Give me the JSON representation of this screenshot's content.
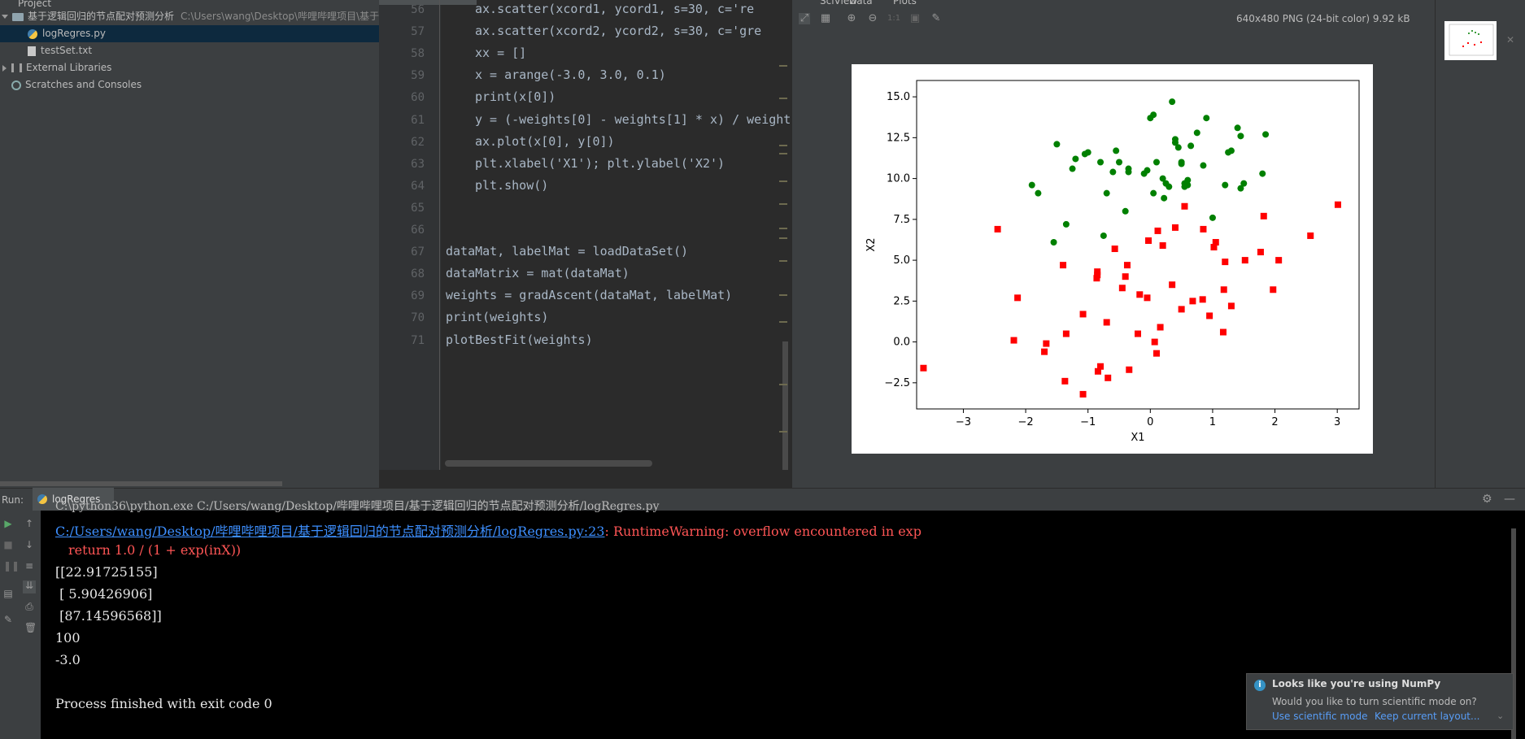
{
  "project": {
    "header_label": "Project",
    "root_folder": "基于逻辑回归的节点配对预测分析",
    "root_path": "C:\\Users\\wang\\Desktop\\哔哩哔哩项目\\基于逻",
    "files": [
      "logRegres.py",
      "testSet.txt"
    ],
    "external_libraries": "External Libraries",
    "scratches": "Scratches and Consoles"
  },
  "editor": {
    "tab_label": "logRegres.py",
    "line_numbers": [
      "56",
      "57",
      "58",
      "59",
      "60",
      "61",
      "62",
      "63",
      "64",
      "65",
      "66",
      "67",
      "68",
      "69",
      "70",
      "71"
    ],
    "lines": [
      "ax.scatter(xcord1, ycord1, s=30, c='re",
      "ax.scatter(xcord2, ycord2, s=30, c='gre",
      "xx = []",
      "x = arange(-3.0, 3.0, 0.1)",
      "print(x[0])",
      "y = (-weights[0] - weights[1] * x) / weight",
      "ax.plot(x[0], y[0])",
      "plt.xlabel('X1'); plt.ylabel('X2')",
      "plt.show()",
      "",
      "",
      "dataMat, labelMat = loadDataSet()",
      "dataMatrix = mat(dataMat)",
      "weights = gradAscent(dataMat, labelMat)",
      "print(weights)",
      "plotBestFit(weights)"
    ]
  },
  "viewer": {
    "tabs": [
      "SciView",
      "Data",
      "Plots"
    ],
    "image_info": "640x480 PNG (24-bit color) 9.92 kB",
    "zoom_one_to_one": "1:1"
  },
  "chart_data": {
    "type": "scatter",
    "title": "",
    "xlabel": "X1",
    "ylabel": "X2",
    "xlim": [
      -3.75,
      3.35
    ],
    "ylim": [
      -4.1,
      16.0
    ],
    "xticks": [
      "−3",
      "−2",
      "−1",
      "0",
      "1",
      "2",
      "3"
    ],
    "yticks": [
      "−2.5",
      "0.0",
      "2.5",
      "5.0",
      "7.5",
      "10.0",
      "12.5",
      "15.0"
    ],
    "xtick_values": [
      -3,
      -2,
      -1,
      0,
      1,
      2,
      3
    ],
    "ytick_values": [
      -2.5,
      0,
      2.5,
      5,
      7.5,
      10,
      12.5,
      15
    ],
    "series": [
      {
        "marker": "square",
        "color": "#ff0000",
        "points": [
          [
            -3.64,
            -1.6
          ],
          [
            -2.45,
            6.9
          ],
          [
            -2.13,
            2.7
          ],
          [
            -2.19,
            0.1
          ],
          [
            -1.67,
            -0.1
          ],
          [
            -1.7,
            -0.6
          ],
          [
            -1.4,
            4.7
          ],
          [
            -1.35,
            0.5
          ],
          [
            -1.37,
            -2.4
          ],
          [
            -1.08,
            1.7
          ],
          [
            -1.08,
            -3.2
          ],
          [
            -0.85,
            4.3
          ],
          [
            -0.85,
            4.1
          ],
          [
            -0.86,
            3.9
          ],
          [
            -0.84,
            -1.8
          ],
          [
            -0.8,
            -1.5
          ],
          [
            -0.7,
            1.2
          ],
          [
            -0.68,
            -2.2
          ],
          [
            -0.57,
            5.7
          ],
          [
            -0.45,
            3.3
          ],
          [
            -0.37,
            4.7
          ],
          [
            -0.4,
            4.0
          ],
          [
            -0.34,
            -1.7
          ],
          [
            -0.2,
            0.5
          ],
          [
            -0.17,
            2.9
          ],
          [
            -0.05,
            2.7
          ],
          [
            -0.03,
            6.2
          ],
          [
            0.07,
            0.0
          ],
          [
            0.1,
            -0.7
          ],
          [
            0.12,
            6.8
          ],
          [
            0.16,
            0.9
          ],
          [
            0.2,
            5.9
          ],
          [
            0.35,
            3.5
          ],
          [
            0.4,
            7.0
          ],
          [
            0.5,
            2.0
          ],
          [
            0.55,
            8.3
          ],
          [
            0.68,
            2.5
          ],
          [
            0.84,
            2.6
          ],
          [
            0.85,
            6.9
          ],
          [
            0.95,
            1.6
          ],
          [
            1.02,
            5.8
          ],
          [
            1.05,
            6.1
          ],
          [
            1.17,
            0.6
          ],
          [
            1.18,
            3.2
          ],
          [
            1.2,
            4.9
          ],
          [
            1.3,
            2.2
          ],
          [
            1.52,
            5.0
          ],
          [
            1.77,
            5.5
          ],
          [
            1.82,
            7.7
          ],
          [
            1.97,
            3.2
          ],
          [
            2.06,
            5.0
          ],
          [
            2.57,
            6.5
          ],
          [
            3.01,
            8.4
          ]
        ]
      },
      {
        "marker": "circle",
        "color": "#008000",
        "points": [
          [
            -1.55,
            6.1
          ],
          [
            -1.5,
            12.1
          ],
          [
            -1.9,
            9.6
          ],
          [
            -1.8,
            9.1
          ],
          [
            -1.35,
            7.2
          ],
          [
            -1.25,
            10.6
          ],
          [
            -1.2,
            11.2
          ],
          [
            -1.05,
            11.5
          ],
          [
            -1.0,
            11.6
          ],
          [
            -0.8,
            11.0
          ],
          [
            -0.75,
            6.5
          ],
          [
            -0.7,
            9.1
          ],
          [
            -0.55,
            11.7
          ],
          [
            -0.6,
            10.4
          ],
          [
            -0.5,
            11.0
          ],
          [
            -0.4,
            8.0
          ],
          [
            -0.35,
            10.6
          ],
          [
            -0.35,
            10.4
          ],
          [
            -0.1,
            10.3
          ],
          [
            -0.05,
            10.5
          ],
          [
            0.0,
            13.7
          ],
          [
            0.05,
            13.9
          ],
          [
            0.05,
            9.1
          ],
          [
            0.1,
            11.0
          ],
          [
            0.2,
            10.0
          ],
          [
            0.22,
            8.8
          ],
          [
            0.25,
            9.7
          ],
          [
            0.3,
            9.5
          ],
          [
            0.35,
            14.7
          ],
          [
            0.4,
            12.4
          ],
          [
            0.4,
            12.2
          ],
          [
            0.45,
            11.9
          ],
          [
            0.5,
            11.0
          ],
          [
            0.5,
            10.9
          ],
          [
            0.55,
            9.7
          ],
          [
            0.55,
            9.5
          ],
          [
            0.6,
            9.6
          ],
          [
            0.6,
            9.9
          ],
          [
            0.65,
            12.0
          ],
          [
            0.75,
            12.8
          ],
          [
            0.85,
            10.8
          ],
          [
            0.9,
            13.7
          ],
          [
            1.0,
            7.6
          ],
          [
            1.2,
            9.6
          ],
          [
            1.25,
            11.6
          ],
          [
            1.3,
            11.7
          ],
          [
            1.4,
            13.1
          ],
          [
            1.45,
            9.4
          ],
          [
            1.45,
            12.6
          ],
          [
            1.5,
            9.7
          ],
          [
            1.8,
            10.3
          ],
          [
            1.85,
            12.7
          ]
        ]
      }
    ]
  },
  "run": {
    "label": "Run:",
    "tab_label": "logRegres",
    "console_lines": [
      {
        "text": "C:\\python36\\python.exe C:/Users/wang/Desktop/哔哩哔哩项目/基于逻辑回归的节点配对预测分析/logRegres.py",
        "kind": "normal"
      },
      {
        "text": "return 1.0 / (1 + exp(inX))",
        "kind": "err"
      },
      {
        "text": "[[22.91725155]",
        "kind": "normal"
      },
      {
        "text": " [ 5.90426906]",
        "kind": "normal"
      },
      {
        "text": " [87.14596568]]",
        "kind": "normal"
      },
      {
        "text": "100",
        "kind": "normal"
      },
      {
        "text": "-3.0",
        "kind": "normal"
      },
      {
        "text": "",
        "kind": "normal"
      },
      {
        "text": "Process finished with exit code 0",
        "kind": "normal"
      }
    ],
    "warning_link": "C:/Users/wang/Desktop/哔哩哔哩项目/基于逻辑回归的节点配对预测分析/logRegres.py:23",
    "warning_text": ": RuntimeWarning: overflow encountered in exp"
  },
  "notification": {
    "title": "Looks like you're using NumPy",
    "body": "Would you like to turn scientific mode on?",
    "action1": "Use scientific mode",
    "action2": "Keep current layout..."
  }
}
